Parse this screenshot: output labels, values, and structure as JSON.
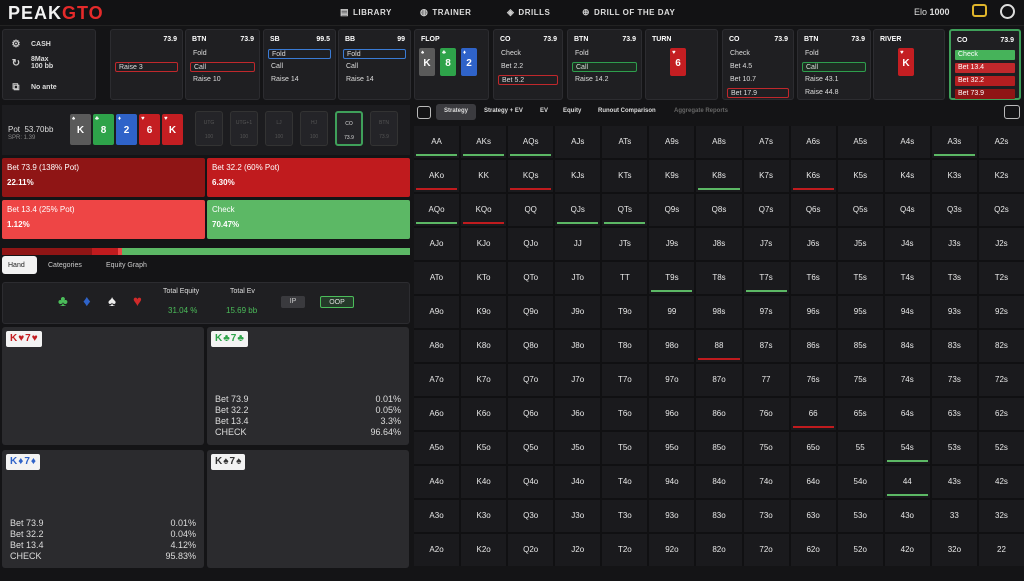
{
  "app": {
    "logo_a": "PEAK",
    "logo_b": "GTO",
    "elo_label": "Elo",
    "elo_value": "1000"
  },
  "nav": [
    {
      "label": "LIBRARY",
      "icon": "library-icon",
      "glyph": "▤"
    },
    {
      "label": "TRAINER",
      "icon": "trainer-icon",
      "glyph": "◍"
    },
    {
      "label": "DRILLS",
      "icon": "drills-icon",
      "glyph": "◈"
    },
    {
      "label": "DRILL OF THE DAY",
      "icon": "drill-of-day-icon",
      "glyph": "⊕"
    }
  ],
  "config": {
    "game": "CASH",
    "table": "8Max",
    "depth": "100 bb",
    "ante": "No ante"
  },
  "action_columns": [
    {
      "pos": "",
      "stack": "73.9",
      "actions": [
        {
          "label": "",
          "style": ""
        },
        {
          "label": "Raise 3",
          "style": "sel-red"
        }
      ]
    },
    {
      "pos": "BTN",
      "stack": "73.9",
      "actions": [
        {
          "label": "Fold",
          "style": ""
        },
        {
          "label": "Call",
          "style": "sel-red"
        },
        {
          "label": "Raise 10",
          "style": ""
        }
      ]
    },
    {
      "pos": "SB",
      "stack": "99.5",
      "actions": [
        {
          "label": "Fold",
          "style": "sel-blue"
        },
        {
          "label": "Call",
          "style": ""
        },
        {
          "label": "Raise 14",
          "style": ""
        }
      ]
    },
    {
      "pos": "BB",
      "stack": "99",
      "actions": [
        {
          "label": "Fold",
          "style": "sel-blue"
        },
        {
          "label": "Call",
          "style": ""
        },
        {
          "label": "Raise 14",
          "style": ""
        }
      ]
    },
    {
      "pos": "FLOP",
      "stack": "",
      "cards": [
        {
          "r": "K",
          "s": "♠",
          "c": "#5a5a5a"
        },
        {
          "r": "8",
          "s": "♣",
          "c": "#2ea34a"
        },
        {
          "r": "2",
          "s": "♦",
          "c": "#2f63c9"
        }
      ]
    },
    {
      "pos": "CO",
      "stack": "73.9",
      "actions": [
        {
          "label": "Check",
          "style": ""
        },
        {
          "label": "Bet 2.2",
          "style": ""
        },
        {
          "label": "Bet 5.2",
          "style": "sel-red"
        }
      ]
    },
    {
      "pos": "BTN",
      "stack": "73.9",
      "actions": [
        {
          "label": "Fold",
          "style": ""
        },
        {
          "label": "Call",
          "style": "sel-green"
        },
        {
          "label": "Raise 14.2",
          "style": ""
        }
      ]
    },
    {
      "pos": "TURN",
      "stack": "",
      "cards": [
        {
          "r": "6",
          "s": "♥",
          "c": "#c41e22"
        }
      ]
    },
    {
      "pos": "CO",
      "stack": "73.9",
      "actions": [
        {
          "label": "Check",
          "style": ""
        },
        {
          "label": "Bet 4.5",
          "style": ""
        },
        {
          "label": "Bet 10.7",
          "style": ""
        },
        {
          "label": "Bet 17.9",
          "style": "sel-red"
        }
      ]
    },
    {
      "pos": "BTN",
      "stack": "73.9",
      "actions": [
        {
          "label": "Fold",
          "style": ""
        },
        {
          "label": "Call",
          "style": "sel-green"
        },
        {
          "label": "Raise 43.1",
          "style": ""
        },
        {
          "label": "Raise 44.8",
          "style": ""
        }
      ]
    },
    {
      "pos": "RIVER",
      "stack": "",
      "cards": [
        {
          "r": "K",
          "s": "♥",
          "c": "#c41e22"
        }
      ]
    },
    {
      "pos": "CO",
      "stack": "73.9",
      "actions": [
        {
          "label": "Check",
          "style": "fill-green"
        },
        {
          "label": "Bet 13.4",
          "style": "fill-red"
        },
        {
          "label": "Bet 32.2",
          "style": "fill-dred"
        },
        {
          "label": "Bet 73.9",
          "style": "fill-ddred"
        }
      ]
    }
  ],
  "pot": {
    "label": "Pot",
    "value": "53.70bb",
    "spr": "SPR: 1.39"
  },
  "board": [
    {
      "r": "K",
      "s": "♠",
      "c": "#5a5a5a"
    },
    {
      "r": "8",
      "s": "♣",
      "c": "#2ea34a"
    },
    {
      "r": "2",
      "s": "♦",
      "c": "#2f63c9"
    },
    {
      "r": "6",
      "s": "♥",
      "c": "#c41e22"
    },
    {
      "r": "K",
      "s": "♥",
      "c": "#c41e22"
    }
  ],
  "positions": [
    {
      "a": "UTG",
      "b": "100"
    },
    {
      "a": "UTG+1",
      "b": "100"
    },
    {
      "a": "LJ",
      "b": "100"
    },
    {
      "a": "HJ",
      "b": "100"
    },
    {
      "a": "CO",
      "b": "73.9",
      "active": true
    },
    {
      "a": "BTN",
      "b": "73.9"
    }
  ],
  "actions_summary": [
    {
      "label": "Bet 73.9 (138% Pot)",
      "value": "22.11%",
      "color": "#8f1515"
    },
    {
      "label": "Bet 32.2 (60% Pot)",
      "value": "6.30%",
      "color": "#c01b1e"
    },
    {
      "label": "Bet 13.4 (25% Pot)",
      "value": "1.12%",
      "color": "#ee4545"
    },
    {
      "label": "Check",
      "value": "70.47%",
      "color": "#5cb865"
    }
  ],
  "dist_pct": [
    22.11,
    6.3,
    1.12,
    70.47
  ],
  "left_tabs": [
    "Hand",
    "Categories",
    "Equity Graph"
  ],
  "suits_filter": [
    {
      "g": "♣",
      "c": "#4bbd5a"
    },
    {
      "g": "♦",
      "c": "#2f63c9"
    },
    {
      "g": "♠",
      "c": "#eeeeee"
    },
    {
      "g": "♥",
      "c": "#d02a2a"
    }
  ],
  "equity": {
    "eq_label": "Total Equity",
    "eq_value": "31.04 %",
    "ev_label": "Total Ev",
    "ev_value": "15.69 bb",
    "ip": "IP",
    "oop": "OOP"
  },
  "hands": [
    {
      "r1": "K",
      "s1": "♥",
      "r2": "7",
      "s2": "♥",
      "col": "#c41e22",
      "rows": []
    },
    {
      "r1": "K",
      "s1": "♣",
      "r2": "7",
      "s2": "♣",
      "col": "#2ea34a",
      "rows": [
        [
          "Bet 73.9",
          "0.01%"
        ],
        [
          "Bet 32.2",
          "0.05%"
        ],
        [
          "Bet 13.4",
          "3.3%"
        ],
        [
          "CHECK",
          "96.64%"
        ]
      ]
    },
    {
      "r1": "K",
      "s1": "♦",
      "r2": "7",
      "s2": "♦",
      "col": "#2f63c9",
      "rows": [
        [
          "Bet 73.9",
          "0.01%"
        ],
        [
          "Bet 32.2",
          "0.04%"
        ],
        [
          "Bet 13.4",
          "4.12%"
        ],
        [
          "CHECK",
          "95.83%"
        ]
      ]
    },
    {
      "r1": "K",
      "s1": "♠",
      "r2": "7",
      "s2": "♠",
      "col": "#333333",
      "rows": []
    }
  ],
  "right_tabs": [
    "Strategy",
    "Strategy + EV",
    "EV",
    "Equity",
    "Runout Comparison",
    "Aggregate Reports"
  ],
  "ranks": [
    "A",
    "K",
    "Q",
    "J",
    "T",
    "9",
    "8",
    "7",
    "6",
    "5",
    "4",
    "3",
    "2"
  ],
  "cell_bars": {
    "AA": "#5cb865",
    "AKs": "#5cb865",
    "AQs": "#5cb865",
    "A3s": "#5cb865",
    "AKo": "#c01b1e",
    "KQs": "#c01b1e",
    "K8s": "#5cb865",
    "K6s": "#c01b1e",
    "AQo": "#5cb865",
    "KQo": "#c01b1e",
    "QJs": "#5cb865",
    "QTs": "#5cb865",
    "T9s": "#5cb865",
    "T7s": "#5cb865",
    "88": "#c01b1e",
    "66": "#c01b1e",
    "54s": "#5cb865",
    "44": "#5cb865"
  }
}
